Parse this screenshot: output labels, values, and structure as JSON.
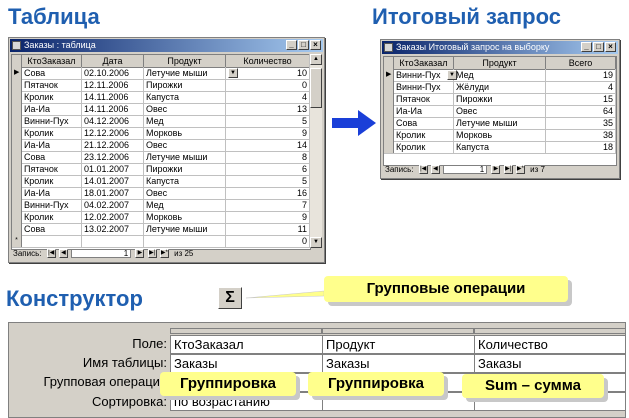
{
  "headings": {
    "table": "Таблица",
    "summary_query": "Итоговый запрос",
    "designer": "Конструктор"
  },
  "table_window": {
    "title": "Заказы : таблица",
    "columns": [
      "КтоЗаказал",
      "Дата",
      "Продукт",
      "Количество"
    ],
    "rows": [
      [
        "Сова",
        "02.10.2006",
        "Летучие мыши",
        "10"
      ],
      [
        "Пятачок",
        "12.11.2006",
        "Пирожки",
        "0"
      ],
      [
        "Кролик",
        "14.11.2006",
        "Капуста",
        "4"
      ],
      [
        "Иа-Иа",
        "14.11.2006",
        "Овес",
        "13"
      ],
      [
        "Винни-Пух",
        "04.12.2006",
        "Мед",
        "5"
      ],
      [
        "Кролик",
        "12.12.2006",
        "Морковь",
        "9"
      ],
      [
        "Иа-Иа",
        "21.12.2006",
        "Овес",
        "14"
      ],
      [
        "Сова",
        "23.12.2006",
        "Летучие мыши",
        "8"
      ],
      [
        "Пятачок",
        "01.01.2007",
        "Пирожки",
        "6"
      ],
      [
        "Кролик",
        "14.01.2007",
        "Капуста",
        "5"
      ],
      [
        "Иа-Иа",
        "18.01.2007",
        "Овес",
        "16"
      ],
      [
        "Винни-Пух",
        "04.02.2007",
        "Мед",
        "7"
      ],
      [
        "Кролик",
        "12.02.2007",
        "Морковь",
        "9"
      ],
      [
        "Сова",
        "13.02.2007",
        "Летучие мыши",
        "11"
      ],
      [
        "",
        "",
        "",
        "0"
      ]
    ],
    "nav": {
      "label": "Запись:",
      "record": "1",
      "of_text": "из 25"
    }
  },
  "query_window": {
    "title": "Заказы Итоговый запрос на выборку",
    "columns": [
      "КтоЗаказал",
      "Продукт",
      "Всего"
    ],
    "rows": [
      [
        "Винни-Пух",
        "Мед",
        "19"
      ],
      [
        "Винни-Пух",
        "Жёлуди",
        "4"
      ],
      [
        "Пятачок",
        "Пирожки",
        "15"
      ],
      [
        "Иа-Иа",
        "Овес",
        "64"
      ],
      [
        "Сова",
        "Летучие мыши",
        "35"
      ],
      [
        "Кролик",
        "Морковь",
        "38"
      ],
      [
        "Кролик",
        "Капуста",
        "18"
      ]
    ],
    "nav": {
      "label": "Запись:",
      "record": "1",
      "of_text": "из 7"
    }
  },
  "sigma_button": {
    "symbol": "Σ"
  },
  "callouts": {
    "group_ops": "Групповые операции",
    "group1": "Группировка",
    "group2": "Группировка",
    "sum": "Sum – сумма"
  },
  "designer": {
    "labels": {
      "field": "Поле:",
      "table": "Имя таблицы:",
      "group": "Групповая операция",
      "sort": "Сортировка:"
    },
    "columns": [
      {
        "field": "КтоЗаказал",
        "table": "Заказы",
        "group": "",
        "sort": "по возрастанию"
      },
      {
        "field": "Продукт",
        "table": "Заказы",
        "group": "",
        "sort": ""
      },
      {
        "field": "Количество",
        "table": "Заказы",
        "group": "",
        "sort": ""
      }
    ]
  },
  "colors": {
    "heading": "#1f5fb0",
    "arrow": "#1a3fd8",
    "callout": "#ffff8c",
    "titlebar": "#0a246a"
  },
  "chart_data": {
    "type": "table",
    "title": "Итоговый запрос",
    "columns": [
      "КтоЗаказал",
      "Продукт",
      "Всего"
    ],
    "rows": [
      [
        "Винни-Пух",
        "Мед",
        19
      ],
      [
        "Винни-Пух",
        "Жёлуди",
        4
      ],
      [
        "Пятачок",
        "Пирожки",
        15
      ],
      [
        "Иа-Иа",
        "Овес",
        64
      ],
      [
        "Сова",
        "Летучие мыши",
        35
      ],
      [
        "Кролик",
        "Морковь",
        38
      ],
      [
        "Кролик",
        "Капуста",
        18
      ]
    ]
  }
}
